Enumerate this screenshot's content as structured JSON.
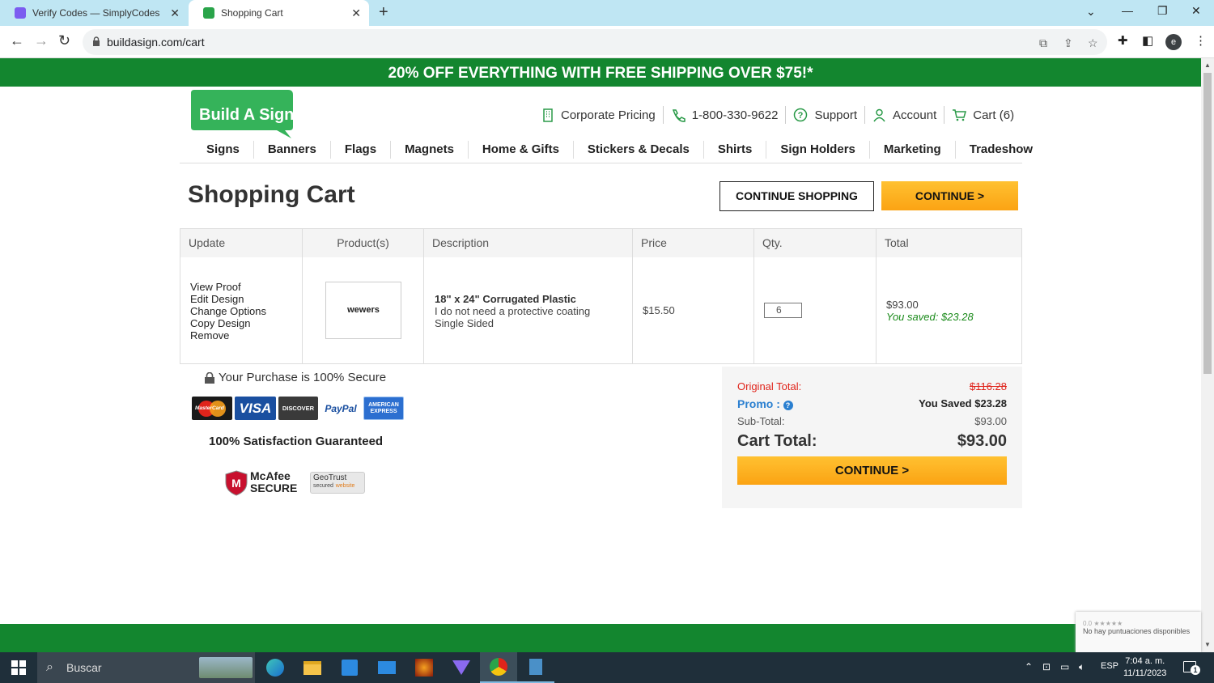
{
  "browser": {
    "tabs": [
      {
        "title": "Verify Codes — SimplyCodes",
        "active": false
      },
      {
        "title": "Shopping Cart",
        "active": true
      }
    ],
    "url": "buildasign.com/cart",
    "profile_initial": "e"
  },
  "promo_banner": "20% OFF EVERYTHING WITH FREE SHIPPING OVER $75!*",
  "header": {
    "logo_text": "Build A Sign",
    "links": [
      {
        "label": "Corporate Pricing",
        "icon": "building-icon"
      },
      {
        "label": "1-800-330-9622",
        "icon": "phone-icon"
      },
      {
        "label": "Support",
        "icon": "help-icon"
      },
      {
        "label": "Account",
        "icon": "user-icon"
      },
      {
        "label": "Cart (6)",
        "icon": "cart-icon"
      }
    ],
    "nav": [
      "Signs",
      "Banners",
      "Flags",
      "Magnets",
      "Home & Gifts",
      "Stickers & Decals",
      "Shirts",
      "Sign Holders",
      "Marketing",
      "Tradeshow"
    ]
  },
  "page": {
    "title": "Shopping Cart",
    "continue_shopping": "CONTINUE SHOPPING",
    "continue": "CONTINUE >"
  },
  "cart_table": {
    "headers": [
      "Update",
      "Product(s)",
      "Description",
      "Price",
      "Qty.",
      "Total"
    ],
    "row": {
      "actions": [
        "View Proof",
        "Edit Design",
        "Change Options",
        "Copy Design",
        "Remove"
      ],
      "thumbnail_text": "wewers",
      "desc_title": "18\" x 24\"  Corrugated Plastic",
      "desc_lines": [
        "I do not need a protective coating",
        "Single Sided"
      ],
      "price": "$15.50",
      "qty": "6",
      "total": "$93.00",
      "saved": "You saved: $23.28"
    }
  },
  "trust": {
    "secure_text": "Your Purchase is 100% Secure",
    "cards": [
      "MasterCard",
      "VISA",
      "DISCOVER",
      "PayPal",
      "AMERICAN EXPRESS"
    ],
    "satisfaction": "100% Satisfaction Guaranteed",
    "mcafee": [
      "McAfee",
      "SECURE"
    ],
    "geotrust": [
      "GeoTrust",
      "secured",
      "website"
    ]
  },
  "summary": {
    "original_label": "Original Total:",
    "original_value": "$116.28",
    "promo_label": "Promo :",
    "promo_value": "You Saved $23.28",
    "subtotal_label": "Sub-Total:",
    "subtotal_value": "$93.00",
    "cart_total_label": "Cart Total:",
    "cart_total_value": "$93.00",
    "continue": "CONTINUE >"
  },
  "recaptcha": {
    "rating": "0.0 ★★★★★",
    "text": "No hay puntuaciones disponibles"
  },
  "taskbar": {
    "search_placeholder": "Buscar",
    "language": "ESP",
    "time": "7:04 a. m.",
    "date": "11/11/2023",
    "notifications": "1"
  },
  "colors": {
    "brand_green": "#13862f",
    "orange": "#fba313",
    "price_red": "#e0241b",
    "saved_green": "#1a8a1a",
    "promo_blue": "#2a7fd0"
  }
}
